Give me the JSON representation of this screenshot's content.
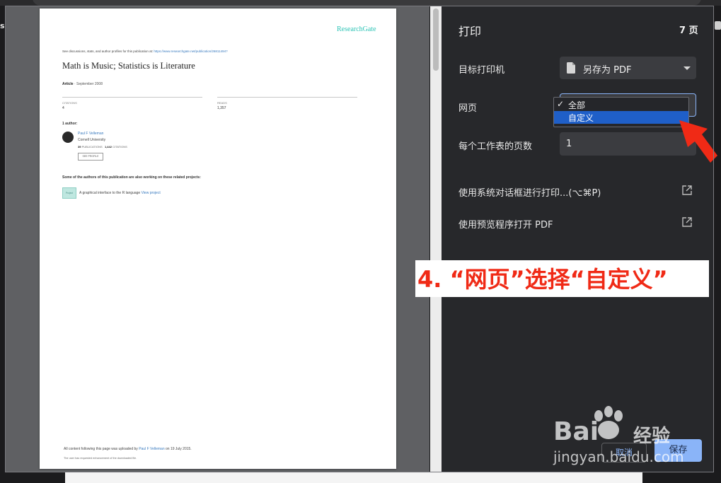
{
  "edges": {
    "left_label": "s"
  },
  "pdf_page": {
    "logo": "ResearchGate",
    "see_discussions": "See discussions, stats, and author profiles for this publication at:",
    "see_link": "https://www.researchgate.net/publication/26811494?",
    "title": "Math is Music; Statistics is Literature",
    "article_type": "Article",
    "article_date": "· September 2008",
    "citations_label": "CITATIONS",
    "citations_value": "4",
    "reads_label": "READS",
    "reads_value": "1,357",
    "authors_heading": "1 author:",
    "author": {
      "name": "Paul F Velleman",
      "institution": "Cornell University",
      "publications_count": "39",
      "publications_label": "PUBLICATIONS",
      "citations_count": "1,442",
      "citations_label": "CITATIONS",
      "profile_button": "SEE PROFILE"
    },
    "projects_heading": "Some of the authors of this publication are also working on these related projects:",
    "project_thumb_label": "Project",
    "project_text": "A graphical interface to the R language",
    "project_link": "View project",
    "uploaded_prefix": "All content following this page was uploaded by",
    "uploader": "Paul F Velleman",
    "uploaded_suffix": "on 19 July 2015.",
    "enhancement_note": "The user has requested enhancement of the downloaded file."
  },
  "panel": {
    "title": "打印",
    "page_count": "7 页",
    "destination_label": "目标打印机",
    "destination_value": "另存为 PDF",
    "pages_label": "网页",
    "pages_options": [
      {
        "check": "✓",
        "label": "全部"
      },
      {
        "label": "自定义"
      }
    ],
    "sheets_label": "每个工作表的页数",
    "sheets_value": "1",
    "system_dialog_label": "使用系统对话框进行打印...(⌥⌘P)",
    "open_preview_label": "使用预览程序打开 PDF",
    "cancel_label": "取消",
    "save_label": "保存"
  },
  "annotation": {
    "text": "4. “网页”选择“自定义”"
  },
  "watermark": {
    "brand": "Bai",
    "brand_suffix": "经验",
    "url": "jingyan.baidu.com"
  },
  "colors": {
    "panel_bg": "#27282b",
    "accent_blue": "#8ab4f8",
    "selected_option": "#1f5fc8",
    "annotation_red": "#f02a16",
    "researchgate_teal": "#2ec4b6"
  }
}
